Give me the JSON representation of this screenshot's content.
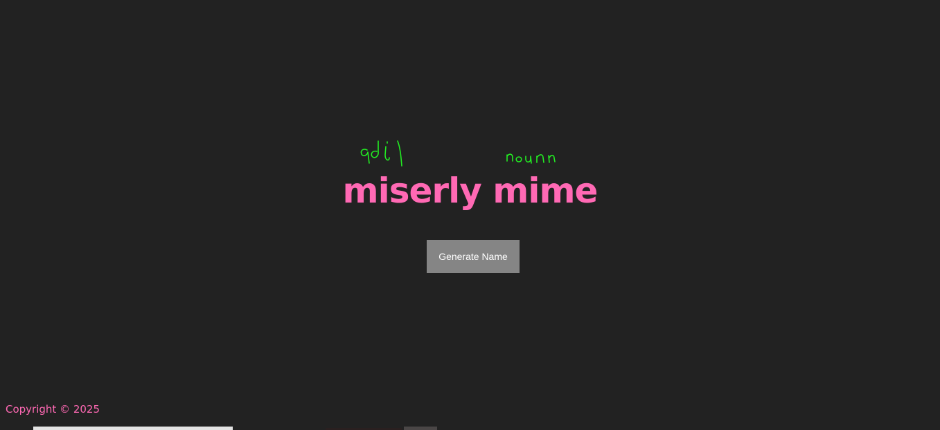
{
  "annotations": {
    "adjective_label": "adj",
    "noun_label": "noun",
    "ink_color": "#22ee22"
  },
  "generated_name": "miserly mime",
  "button": {
    "label": "Generate Name"
  },
  "footer": {
    "copyright": "Copyright © 2025"
  },
  "colors": {
    "background": "#222222",
    "accent": "#ff69b4",
    "button_background": "#858585",
    "button_text": "#ffffff"
  }
}
